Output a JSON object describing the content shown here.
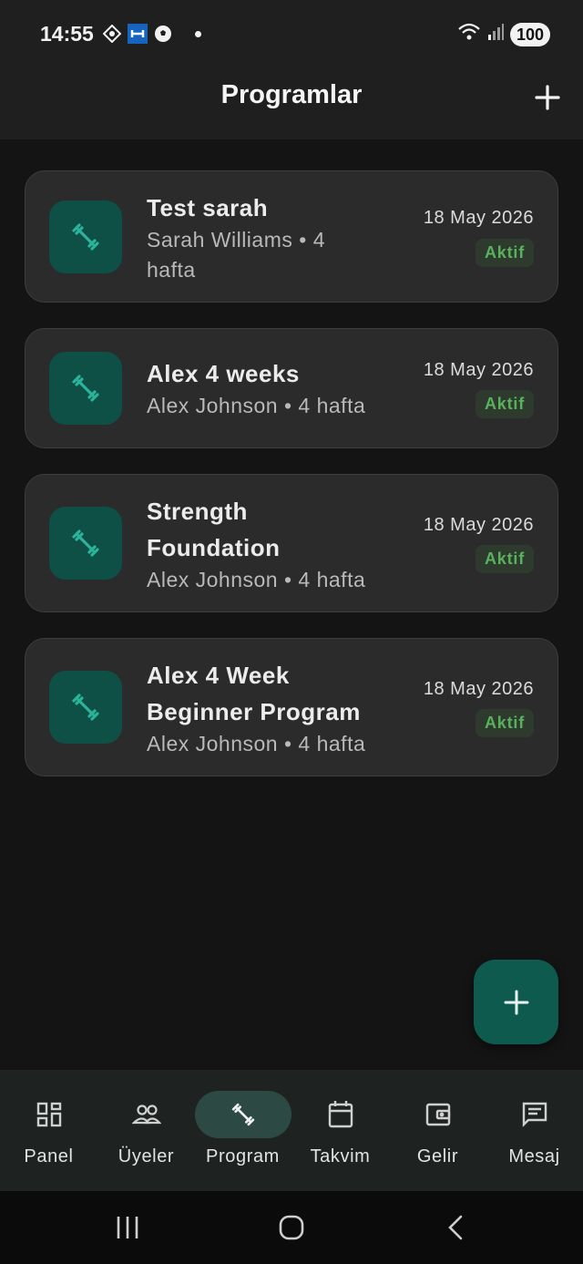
{
  "status_bar": {
    "time": "14:55",
    "battery": "100",
    "icons": [
      "navigation-app-icon",
      "dumbbell-app-icon",
      "soccer-ball-icon",
      "notification-dot-icon",
      "wifi-icon",
      "signal-icon"
    ]
  },
  "header": {
    "title": "Programlar",
    "add_icon": "plus-icon"
  },
  "programs": [
    {
      "title": "Test sarah",
      "subtitle": "Sarah Williams • 4 hafta",
      "date": "18 May 2026",
      "status": "Aktif",
      "icon": "dumbbell-icon"
    },
    {
      "title": "Alex 4 weeks",
      "subtitle": "Alex Johnson • 4 hafta",
      "date": "18 May 2026",
      "status": "Aktif",
      "icon": "dumbbell-icon"
    },
    {
      "title": "Strength Foundation",
      "subtitle": "Alex Johnson • 4 hafta",
      "date": "18 May 2026",
      "status": "Aktif",
      "icon": "dumbbell-icon"
    },
    {
      "title": "Alex 4 Week Beginner Program",
      "subtitle": "Alex Johnson • 4 hafta",
      "date": "18 May 2026",
      "status": "Aktif",
      "icon": "dumbbell-icon"
    }
  ],
  "fab": {
    "icon": "plus-icon"
  },
  "bottom_nav": {
    "items": [
      {
        "label": "Panel",
        "icon": "dashboard-icon",
        "active": false
      },
      {
        "label": "Üyeler",
        "icon": "people-icon",
        "active": false
      },
      {
        "label": "Program",
        "icon": "dumbbell-icon",
        "active": true
      },
      {
        "label": "Takvim",
        "icon": "calendar-icon",
        "active": false
      },
      {
        "label": "Gelir",
        "icon": "wallet-icon",
        "active": false
      },
      {
        "label": "Mesaj",
        "icon": "message-icon",
        "active": false
      }
    ]
  },
  "system_nav": {
    "icons": [
      "recents-icon",
      "home-icon",
      "back-icon"
    ]
  },
  "colors": {
    "background": "#141414",
    "card": "#2b2b2b",
    "accent": "#0e5a4f",
    "badge_text": "#58b25c",
    "icon_tint": "#2bb39b"
  }
}
